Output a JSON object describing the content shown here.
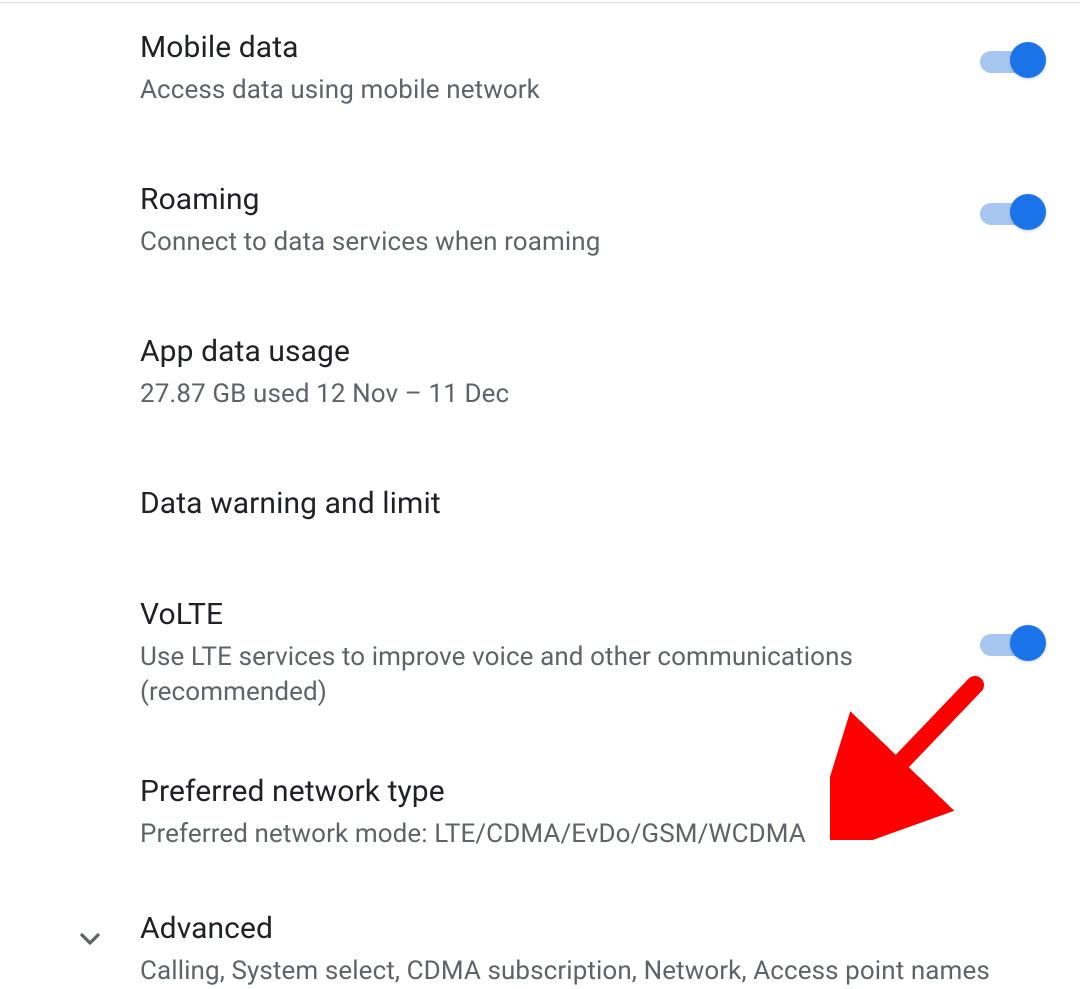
{
  "settings": {
    "items": [
      {
        "key": "mobile-data",
        "title": "Mobile data",
        "subtitle": "Access data using mobile network",
        "toggle": true,
        "toggle_on": true
      },
      {
        "key": "roaming",
        "title": "Roaming",
        "subtitle": "Connect to data services when roaming",
        "toggle": true,
        "toggle_on": true
      },
      {
        "key": "app-data-usage",
        "title": "App data usage",
        "subtitle": "27.87 GB used 12 Nov – 11 Dec",
        "toggle": false
      },
      {
        "key": "data-warning-limit",
        "title": "Data warning and limit",
        "subtitle": "",
        "toggle": false
      },
      {
        "key": "volte",
        "title": "VoLTE",
        "subtitle": "Use LTE services to improve voice and other communications (recommended)",
        "toggle": true,
        "toggle_on": true
      },
      {
        "key": "preferred-network-type",
        "title": "Preferred network type",
        "subtitle": "Preferred network mode: LTE/CDMA/EvDo/GSM/WCDMA",
        "toggle": false
      }
    ],
    "advanced": {
      "title": "Advanced",
      "subtitle": "Calling, System select, CDMA subscription, Network, Access point names"
    }
  },
  "annotation": {
    "type": "arrow",
    "color": "#ff0000"
  }
}
